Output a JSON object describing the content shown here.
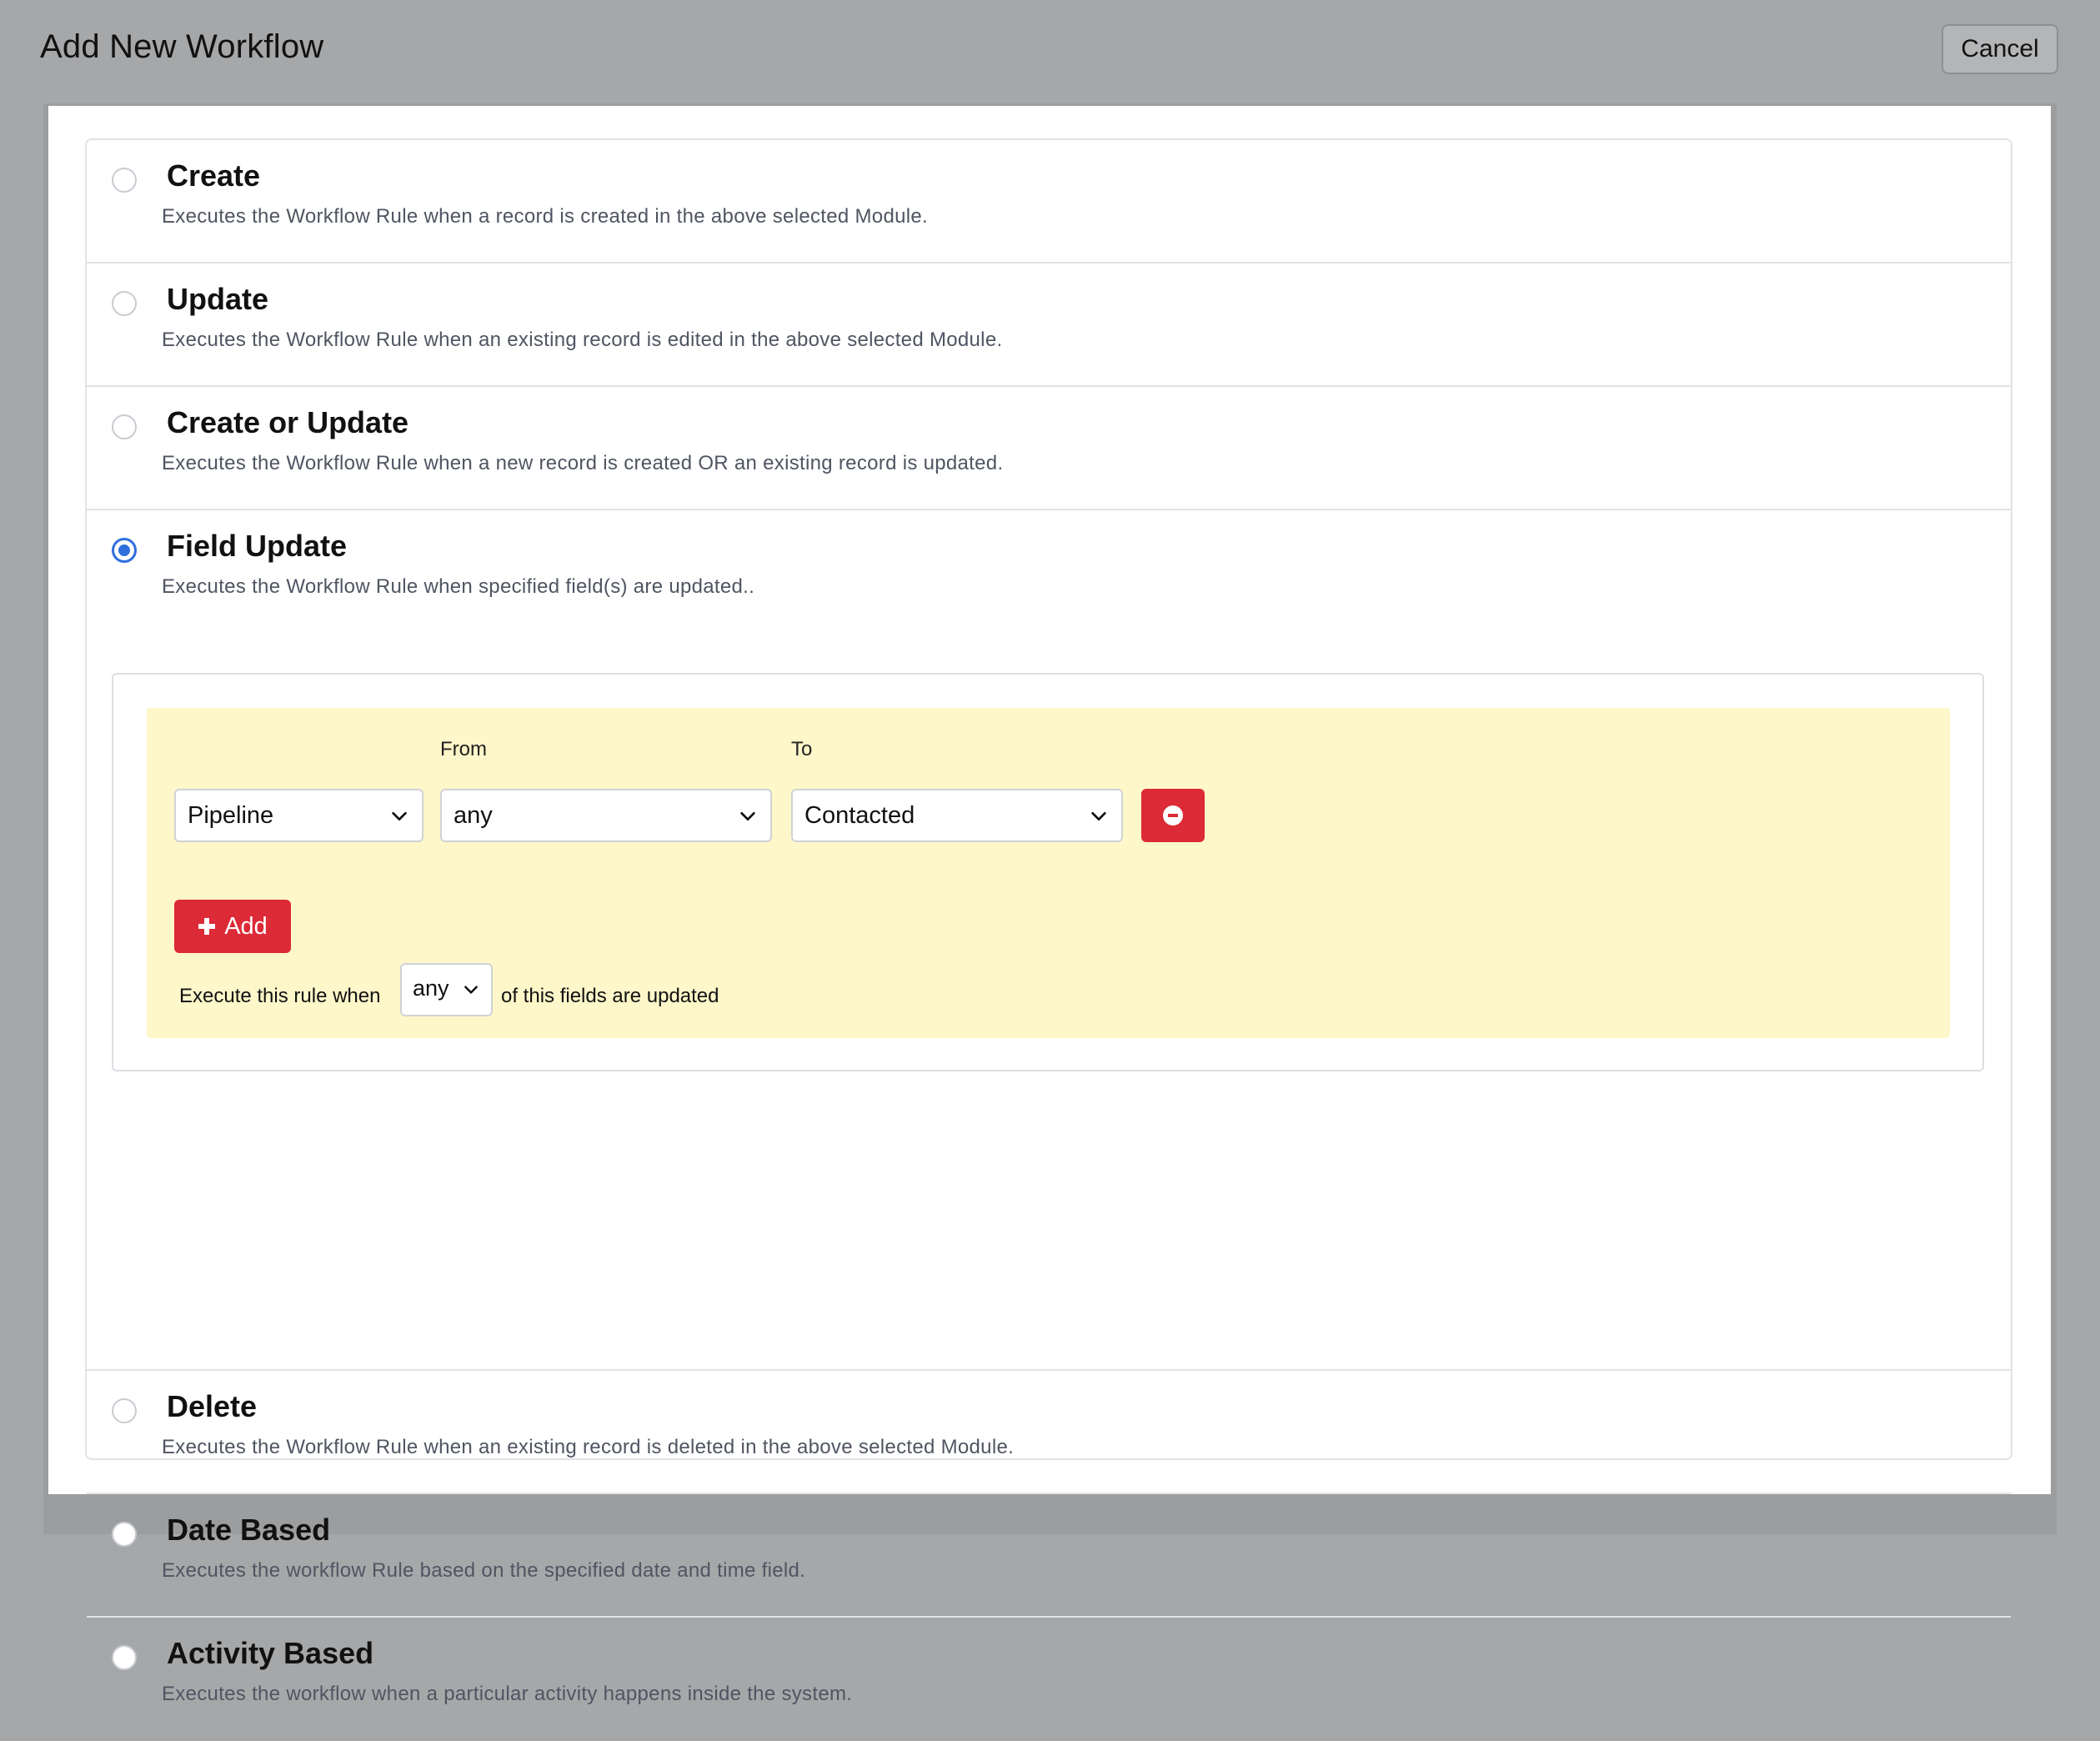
{
  "header": {
    "title": "Add New Workflow",
    "cancel_label": "Cancel"
  },
  "options": [
    {
      "title": "Create",
      "description": "Executes the Workflow Rule when a record is created in the above selected Module.",
      "selected": false
    },
    {
      "title": "Update",
      "description": "Executes the Workflow Rule when an existing record is edited in the above selected Module.",
      "selected": false
    },
    {
      "title": "Create or Update",
      "description": "Executes the Workflow Rule when a new record is created OR an existing record is updated.",
      "selected": false
    },
    {
      "title": "Field Update",
      "description": "Executes the Workflow Rule when specified field(s) are updated..",
      "selected": true
    },
    {
      "title": "Delete",
      "description": "Executes the Workflow Rule when an existing record is deleted in the above selected Module.",
      "selected": false
    },
    {
      "title": "Date Based",
      "description": "Executes the workflow Rule based on the specified date and time field.",
      "selected": false
    },
    {
      "title": "Activity Based",
      "description": "Executes the workflow when a particular activity happens inside the system.",
      "selected": false
    }
  ],
  "field_update": {
    "from_label": "From",
    "to_label": "To",
    "rule": {
      "field": "Pipeline",
      "from": "any",
      "to": "Contacted"
    },
    "add_label": "Add",
    "execute_prefix": "Execute this rule when",
    "execute_match": "any",
    "execute_suffix": "of this fields are updated"
  },
  "colors": {
    "accent_blue": "#2f6fde",
    "danger_red": "#dc2a36",
    "condition_bg": "#fdf7c9",
    "overlay_gray": "#a6a7a9"
  }
}
